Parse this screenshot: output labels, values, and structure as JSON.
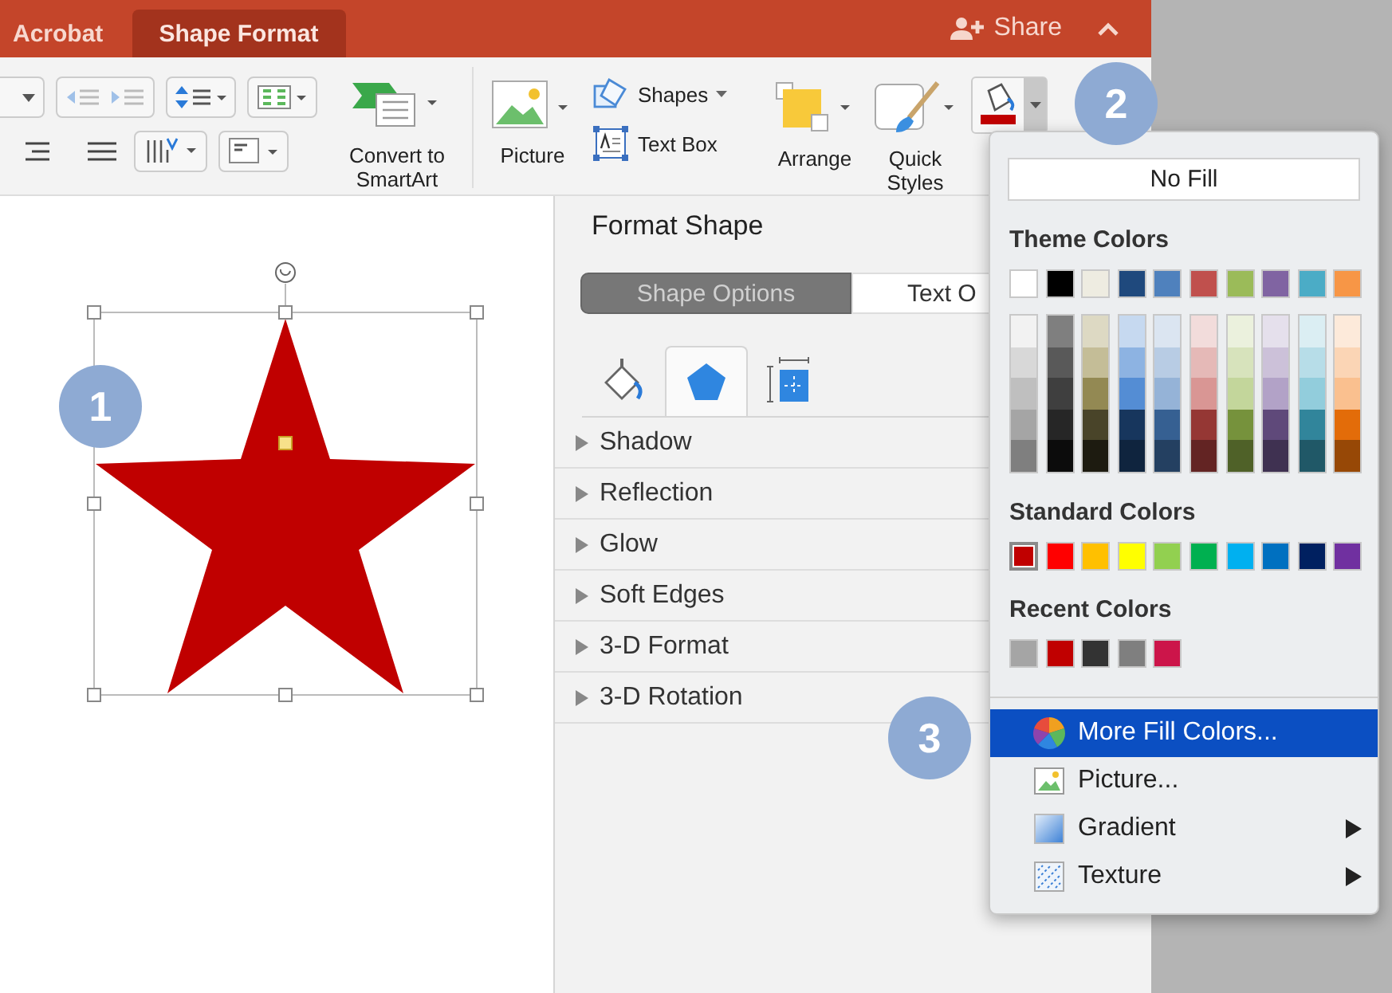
{
  "ribbon": {
    "tabs": [
      {
        "label": "Acrobat",
        "selected": false
      },
      {
        "label": "Shape Format",
        "selected": true
      }
    ],
    "share": "Share",
    "convert": "Convert to SmartArt",
    "picture": "Picture",
    "shapes": "Shapes",
    "text_box": "Text Box",
    "arrange": "Arrange",
    "quick_styles": "Quick Styles"
  },
  "callouts": [
    {
      "label": "1"
    },
    {
      "label": "2"
    },
    {
      "label": "3"
    }
  ],
  "format_panel": {
    "title": "Format Shape",
    "segments": [
      {
        "label": "Shape Options",
        "selected": true
      },
      {
        "label": "Text O",
        "selected": false
      }
    ],
    "icon_tabs": [
      {
        "kind": "fill",
        "selected": false
      },
      {
        "kind": "shape",
        "selected": true
      },
      {
        "kind": "size",
        "selected": false
      }
    ],
    "sections": [
      {
        "label": "Shadow",
        "expanded": false
      },
      {
        "label": "Reflection",
        "expanded": false
      },
      {
        "label": "Glow",
        "expanded": false
      },
      {
        "label": "Soft Edges",
        "expanded": false
      },
      {
        "label": "3-D Format",
        "expanded": false
      },
      {
        "label": "3-D Rotation",
        "expanded": false
      }
    ]
  },
  "fill_menu": {
    "no_fill": "No Fill",
    "theme_label": "Theme Colors",
    "theme_base": [
      {
        "color": "#ffffff"
      },
      {
        "color": "#000000"
      },
      {
        "color": "#eeece1"
      },
      {
        "color": "#1f497d"
      },
      {
        "color": "#4f81bd"
      },
      {
        "color": "#c0504d"
      },
      {
        "color": "#9bbb59"
      },
      {
        "color": "#8064a2"
      },
      {
        "color": "#4bacc6"
      },
      {
        "color": "#f79646"
      }
    ],
    "theme_shades": [
      [
        {
          "color": "#f2f2f2"
        },
        {
          "color": "#d8d8d8"
        },
        {
          "color": "#bfbfbf"
        },
        {
          "color": "#a5a5a5"
        },
        {
          "color": "#7f7f7f"
        }
      ],
      [
        {
          "color": "#7f7f7f"
        },
        {
          "color": "#595959"
        },
        {
          "color": "#3f3f3f"
        },
        {
          "color": "#262626"
        },
        {
          "color": "#0c0c0c"
        }
      ],
      [
        {
          "color": "#ddd9c3"
        },
        {
          "color": "#c4bd97"
        },
        {
          "color": "#938953"
        },
        {
          "color": "#494429"
        },
        {
          "color": "#1d1b10"
        }
      ],
      [
        {
          "color": "#c6d9f0"
        },
        {
          "color": "#8db3e2"
        },
        {
          "color": "#548dd4"
        },
        {
          "color": "#17365d"
        },
        {
          "color": "#0f243e"
        }
      ],
      [
        {
          "color": "#dbe5f1"
        },
        {
          "color": "#b8cce4"
        },
        {
          "color": "#95b3d7"
        },
        {
          "color": "#366092"
        },
        {
          "color": "#244061"
        }
      ],
      [
        {
          "color": "#f2dcdb"
        },
        {
          "color": "#e5b9b7"
        },
        {
          "color": "#d99694"
        },
        {
          "color": "#953734"
        },
        {
          "color": "#632423"
        }
      ],
      [
        {
          "color": "#ebf1dd"
        },
        {
          "color": "#d7e3bc"
        },
        {
          "color": "#c3d69b"
        },
        {
          "color": "#76923c"
        },
        {
          "color": "#4f6128"
        }
      ],
      [
        {
          "color": "#e5e0ec"
        },
        {
          "color": "#ccc1d9"
        },
        {
          "color": "#b2a2c7"
        },
        {
          "color": "#5f497a"
        },
        {
          "color": "#3f3151"
        }
      ],
      [
        {
          "color": "#dbeef3"
        },
        {
          "color": "#b7dde8"
        },
        {
          "color": "#92cddc"
        },
        {
          "color": "#31859b"
        },
        {
          "color": "#205867"
        }
      ],
      [
        {
          "color": "#fdeada"
        },
        {
          "color": "#fbd5b5"
        },
        {
          "color": "#fac08f"
        },
        {
          "color": "#e36c09"
        },
        {
          "color": "#974806"
        }
      ]
    ],
    "standard_label": "Standard Colors",
    "standard": [
      {
        "color": "#c00000",
        "selected": true
      },
      {
        "color": "#ff0000",
        "selected": false
      },
      {
        "color": "#ffc000",
        "selected": false
      },
      {
        "color": "#ffff00",
        "selected": false
      },
      {
        "color": "#92d050",
        "selected": false
      },
      {
        "color": "#00b050",
        "selected": false
      },
      {
        "color": "#00b0f0",
        "selected": false
      },
      {
        "color": "#0070c0",
        "selected": false
      },
      {
        "color": "#002060",
        "selected": false
      },
      {
        "color": "#7030a0",
        "selected": false
      }
    ],
    "recent_label": "Recent Colors",
    "recent": [
      {
        "color": "#a5a5a5"
      },
      {
        "color": "#c00000"
      },
      {
        "color": "#333333"
      },
      {
        "color": "#7f7f7f"
      },
      {
        "color": "#cc154a"
      }
    ],
    "items": [
      {
        "kind": "colors",
        "label": "More Fill Colors...",
        "selected": true,
        "submenu": false
      },
      {
        "kind": "picture",
        "label": "Picture...",
        "selected": false,
        "submenu": false
      },
      {
        "kind": "gradient",
        "label": "Gradient",
        "selected": false,
        "submenu": true
      },
      {
        "kind": "texture",
        "label": "Texture",
        "selected": false,
        "submenu": true
      }
    ]
  }
}
